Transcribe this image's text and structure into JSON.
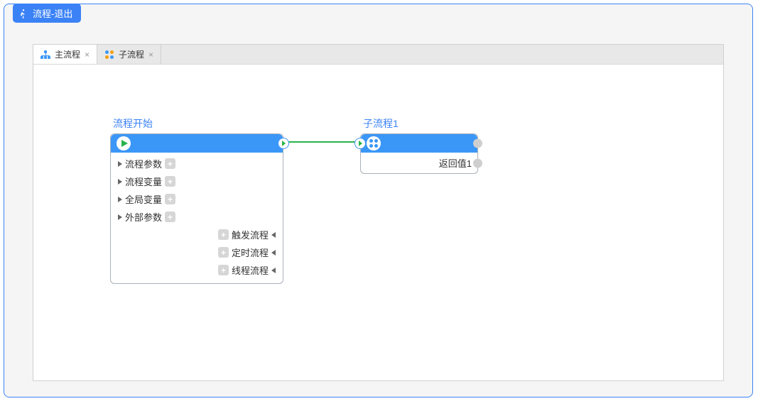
{
  "panel": {
    "title": "流程-退出"
  },
  "tabs": [
    {
      "label": "主流程",
      "active": true
    },
    {
      "label": "子流程",
      "active": false
    }
  ],
  "node1": {
    "title": "流程开始",
    "left_params": [
      {
        "label": "流程参数"
      },
      {
        "label": "流程变量"
      },
      {
        "label": "全局变量"
      },
      {
        "label": "外部参数"
      }
    ],
    "right_params": [
      {
        "label": "触发流程"
      },
      {
        "label": "定时流程"
      },
      {
        "label": "线程流程"
      }
    ]
  },
  "node2": {
    "title": "子流程1",
    "return_label": "返回值1"
  }
}
